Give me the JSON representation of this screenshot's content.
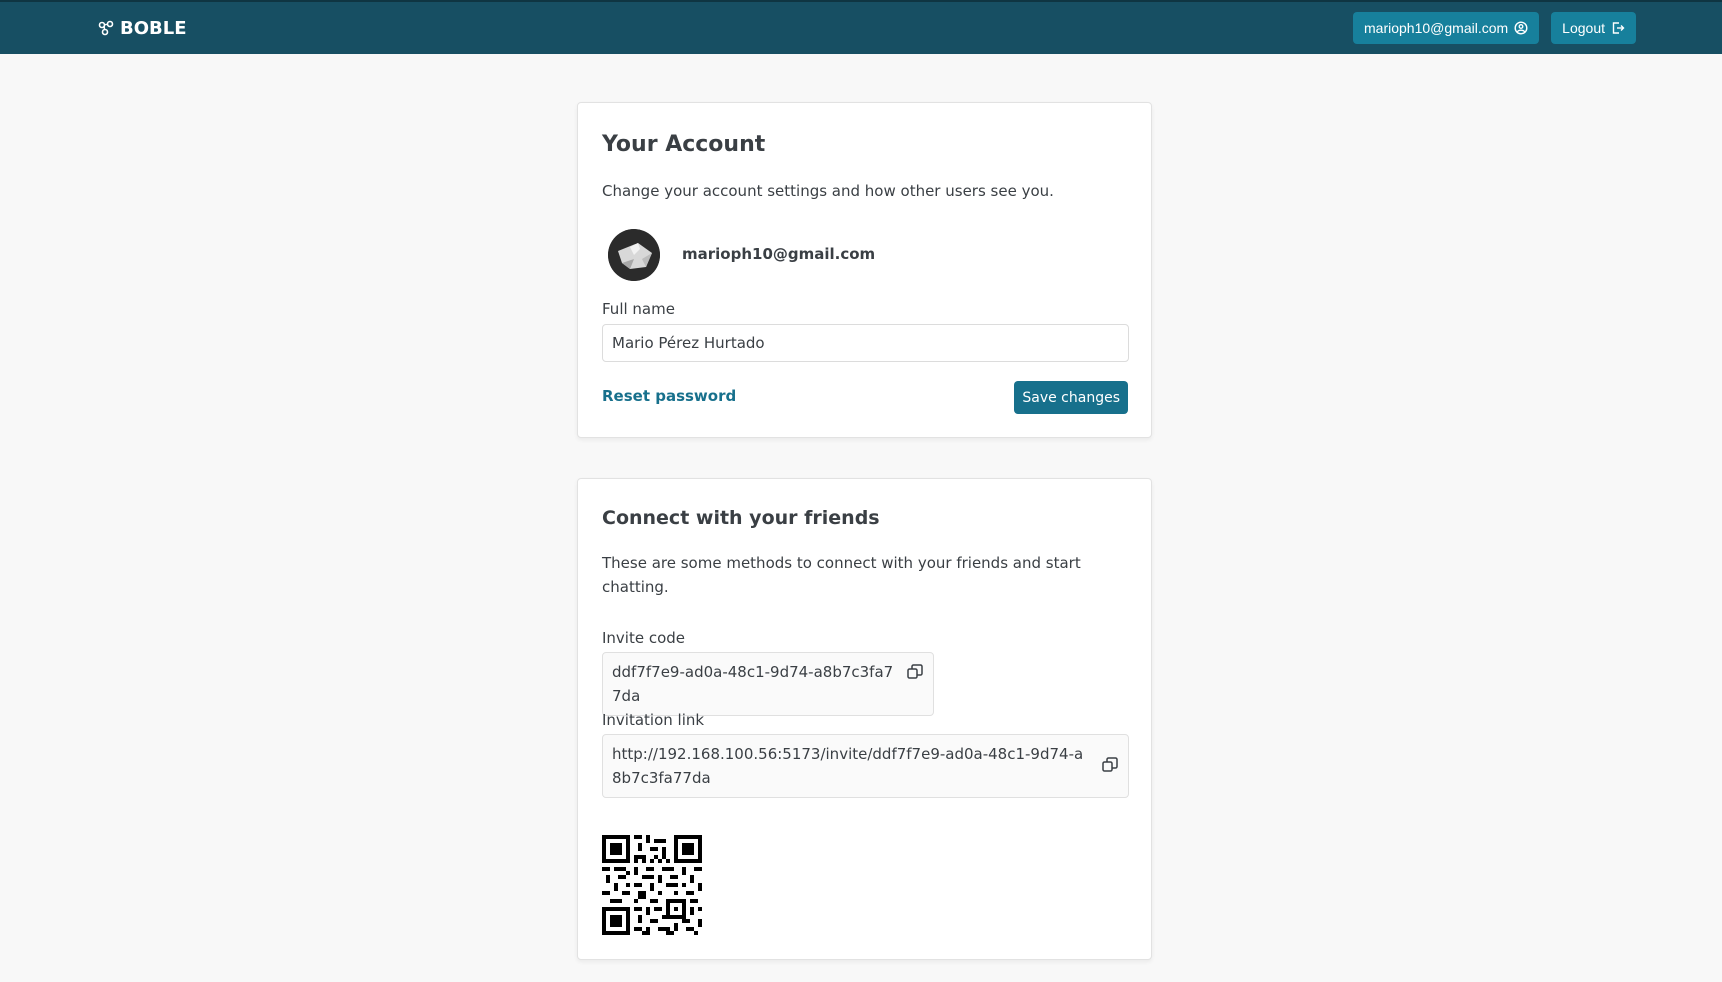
{
  "nav": {
    "brand": "BOBLE",
    "account_button": "marioph10@gmail.com",
    "logout_button": "Logout"
  },
  "account_card": {
    "title": "Your Account",
    "description": "Change your account settings and how other users see you.",
    "email": "marioph10@gmail.com",
    "full_name_label": "Full name",
    "full_name_value": "Mario Pérez Hurtado",
    "reset_password": "Reset password",
    "save_changes": "Save changes"
  },
  "friends_card": {
    "title": "Connect with your friends",
    "description": "These are some methods to connect with your friends and start chatting.",
    "invite_code_label": "Invite code",
    "invite_code": "ddf7f7e9-ad0a-48c1-9d74-a8b7c3fa77da",
    "invitation_link_label": "Invitation link",
    "invitation_link": "http://192.168.100.56:5173/invite/ddf7f7e9-ad0a-48c1-9d74-a8b7c3fa77da"
  },
  "icons": {
    "brand": "share-nodes-icon",
    "account": "user-circle-icon",
    "logout": "logout-icon",
    "copy": "copy-icon"
  },
  "colors": {
    "navbar": "#174f63",
    "nav_button": "#17809c",
    "primary": "#17708c"
  }
}
